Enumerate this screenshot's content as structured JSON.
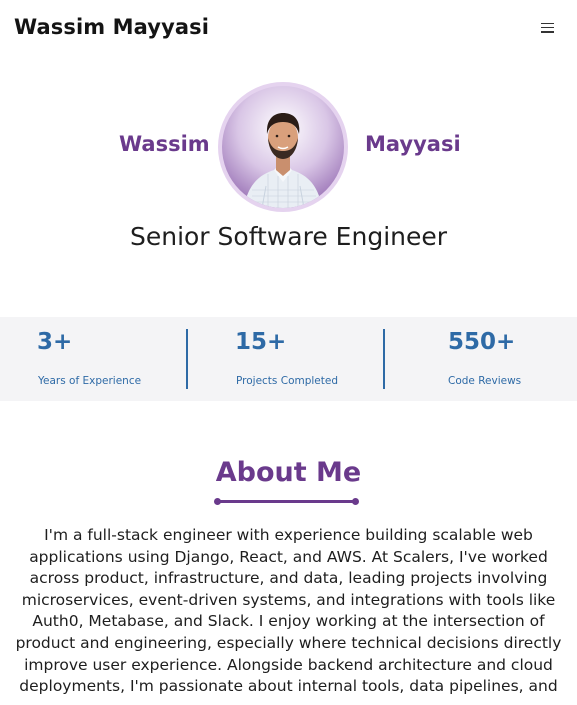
{
  "nav": {
    "brand": "Wassim Mayyasi",
    "menu_icon": "hamburger-icon"
  },
  "hero": {
    "first_name": "Wassim",
    "last_name": "Mayyasi",
    "title": "Senior Software Engineer",
    "avatar_icon": "profile-photo"
  },
  "stats": [
    {
      "value": "3+",
      "label": "Years of Experience"
    },
    {
      "value": "15+",
      "label": "Projects Completed"
    },
    {
      "value": "550+",
      "label": "Code Reviews"
    }
  ],
  "about": {
    "title": "About Me",
    "text": "I'm a full-stack engineer with experience building scalable web applications using Django, React, and AWS. At Scalers, I've worked across product, infrastructure, and data, leading projects involving microservices, event-driven systems, and integrations with tools like Auth0, Metabase, and Slack. I enjoy working at the intersection of product and engineering, especially where technical decisions directly improve user experience. Alongside backend architecture and cloud deployments, I'm passionate about internal tools, data pipelines, and"
  },
  "colors": {
    "accent_purple": "#6a3a8c",
    "accent_blue": "#2e6aa6",
    "stats_bg": "#f4f4f6"
  }
}
